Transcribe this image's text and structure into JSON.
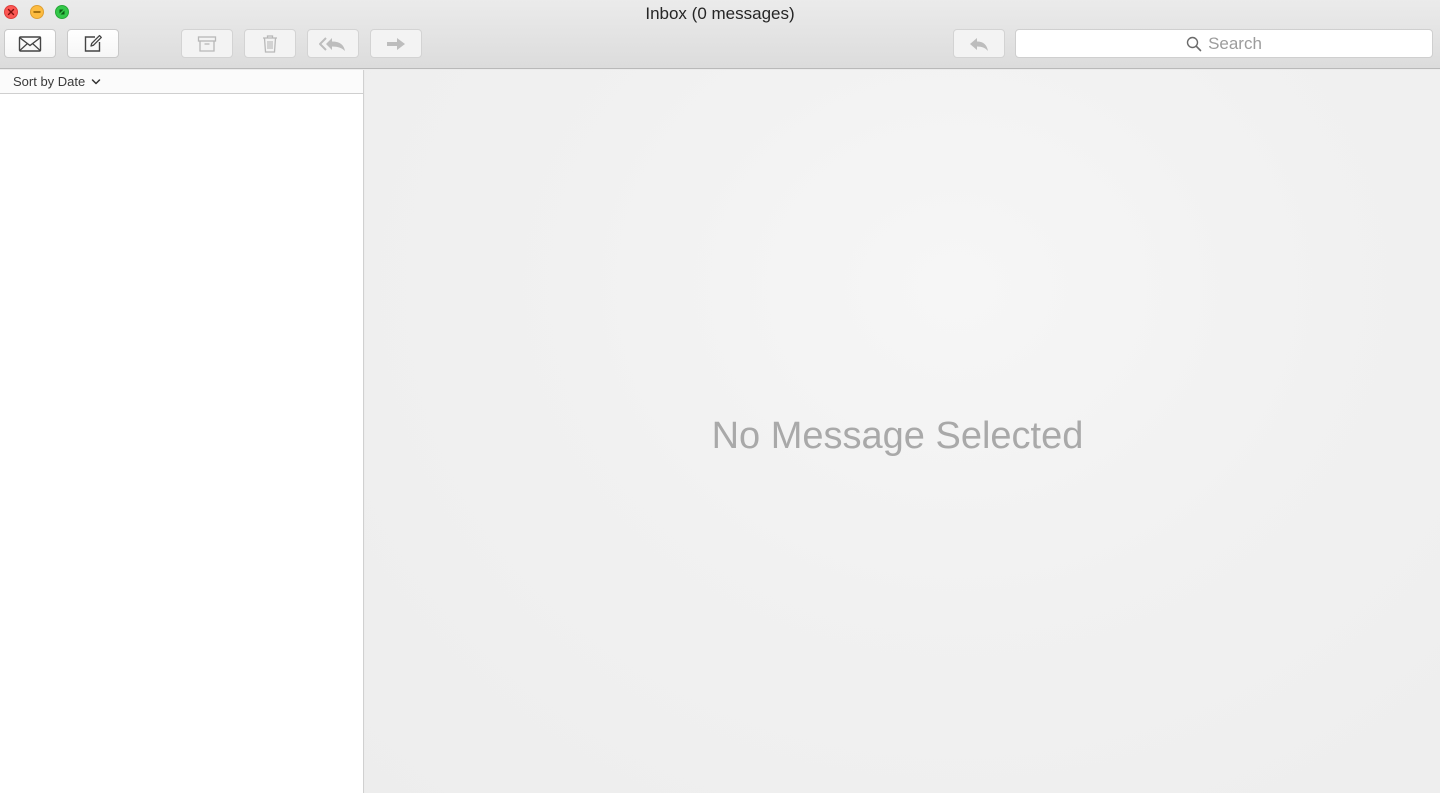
{
  "window": {
    "title": "Inbox (0 messages)"
  },
  "toolbar": {
    "get_mail_icon": "envelope-icon",
    "compose_icon": "compose-icon",
    "archive_icon": "archive-box-icon",
    "delete_icon": "trash-icon",
    "reply_all_icon": "reply-all-icon",
    "forward_icon": "forward-arrow-icon",
    "reply_icon": "reply-arrow-icon"
  },
  "search": {
    "placeholder": "Search"
  },
  "message_list": {
    "sort_label": "Sort by Date"
  },
  "preview": {
    "empty_message": "No Message Selected"
  },
  "colors": {
    "close": "#fc5753",
    "minimize": "#fdbc40",
    "zoom": "#34c84a"
  }
}
